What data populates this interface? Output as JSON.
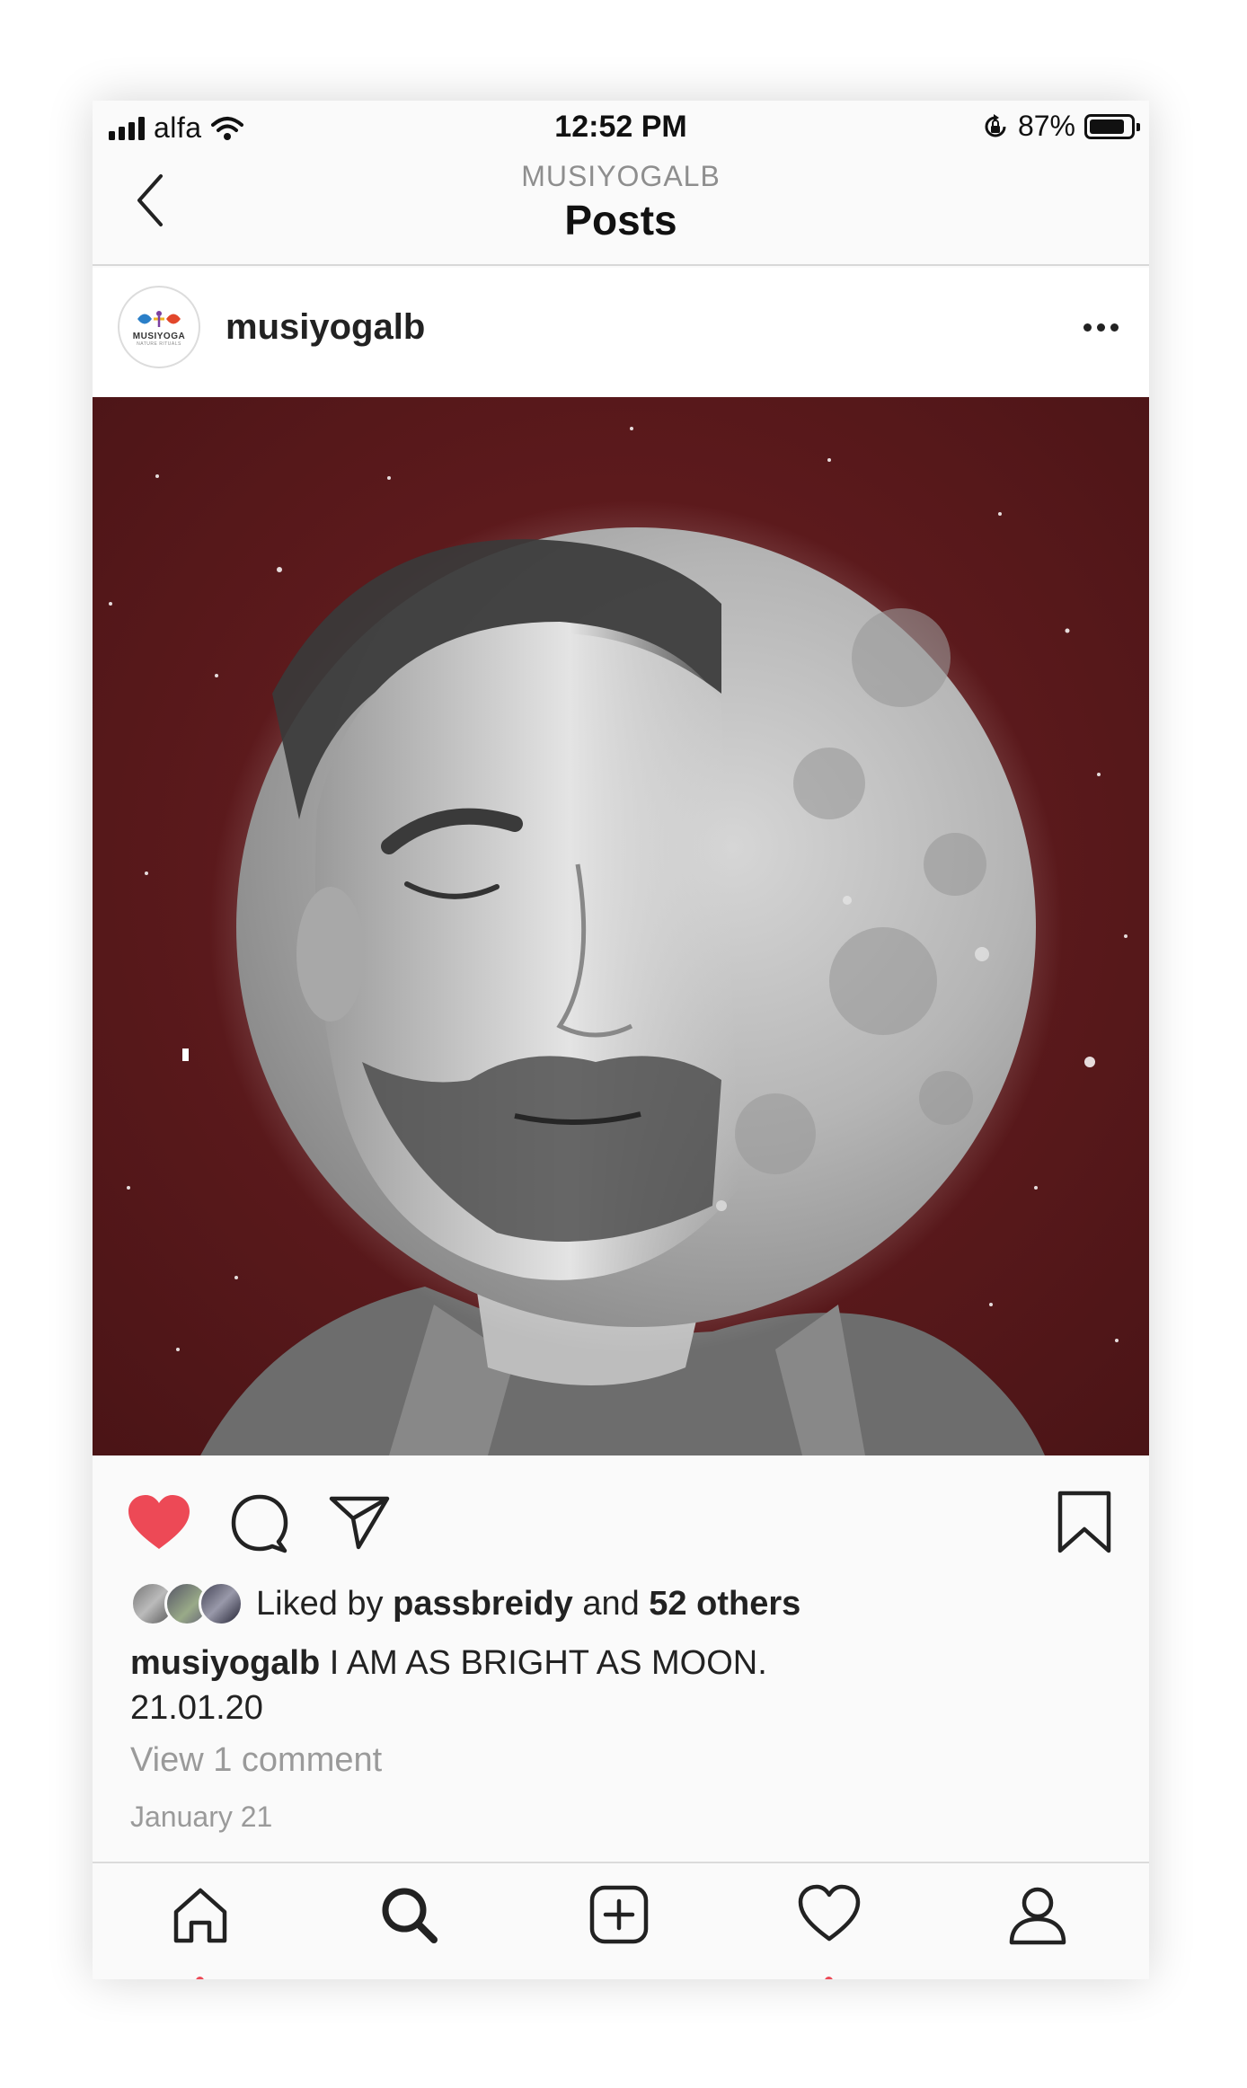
{
  "status_bar": {
    "carrier": "alfa",
    "time": "12:52 PM",
    "battery_percent": "87%",
    "battery_level": 0.87
  },
  "header": {
    "account_name": "MUSIYOGALB",
    "title": "Posts"
  },
  "post": {
    "username": "musiyogalb",
    "avatar_logo": {
      "brand": "MUSIYOGA",
      "tagline": "NATURE RITUALS"
    },
    "image": {
      "description_icon": "moon-face-photo",
      "background_color": "#5a1a1c"
    },
    "liked": true,
    "likes": {
      "prefix": "Liked by",
      "first_user": "passbreidy",
      "joiner": "and",
      "others": "52 others"
    },
    "caption": {
      "username": "musiyogalb",
      "text": "I AM AS BRIGHT AS MOON.",
      "line2": "21.01.20"
    },
    "view_comments": "View 1 comment",
    "date": "January 21"
  },
  "tab_bar": {
    "items": [
      "home-icon",
      "search-icon",
      "add-post-icon",
      "activity-icon",
      "profile-icon"
    ]
  },
  "colors": {
    "like_red": "#ed4956",
    "text_primary": "#222222",
    "text_secondary": "#8e8e8e"
  }
}
